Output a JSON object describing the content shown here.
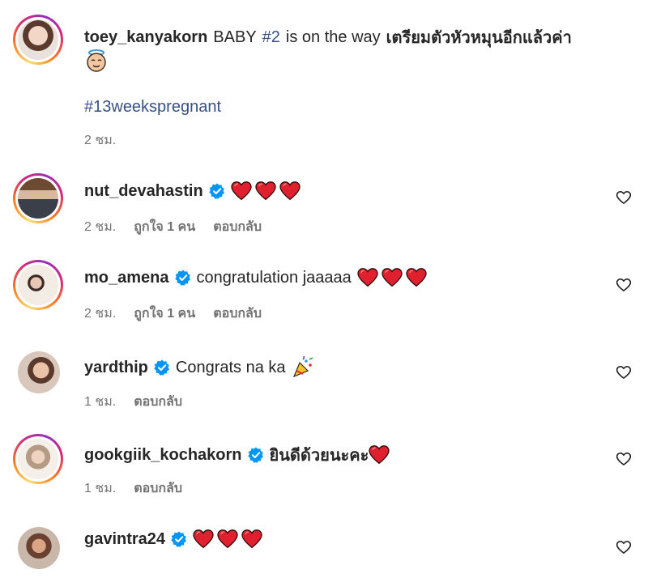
{
  "caption": {
    "username": "toey_kanyakorn",
    "text_pre": "BABY",
    "hashtag_num": "#2",
    "text_mid": "is on the way",
    "text_thai": "เตรียมตัวหัวหมุนอีกแล้วค่า",
    "hashtag": "#13weekspregnant",
    "time": "2 ชม."
  },
  "comments": [
    {
      "username": "nut_devahastin",
      "verified": true,
      "text": "",
      "emoji": [
        "red-heart",
        "red-heart",
        "red-heart"
      ],
      "time": "2 ชม.",
      "likes": "ถูกใจ 1 คน",
      "reply": "ตอบกลับ"
    },
    {
      "username": "mo_amena",
      "verified": true,
      "text": "congratulation jaaaaa",
      "emoji": [
        "red-heart",
        "red-heart",
        "red-heart"
      ],
      "time": "2 ชม.",
      "likes": "ถูกใจ 1 คน",
      "reply": "ตอบกลับ"
    },
    {
      "username": "yardthip",
      "verified": true,
      "text": "Congrats na ka",
      "emoji": [
        "party-popper"
      ],
      "time": "1 ชม.",
      "likes": "",
      "reply": "ตอบกลับ"
    },
    {
      "username": "gookgiik_kochakorn",
      "verified": true,
      "text": "ยินดีด้วยนะคะ",
      "emoji": [
        "red-heart"
      ],
      "time": "1 ชม.",
      "likes": "",
      "reply": "ตอบกลับ"
    },
    {
      "username": "gavintra24",
      "verified": true,
      "text": "",
      "emoji": [
        "red-heart",
        "red-heart",
        "red-heart"
      ],
      "time": "",
      "likes": "",
      "reply": ""
    }
  ],
  "colors": {
    "hashtag": "#385185",
    "verified": "#0095f6",
    "heart": "#e0202e",
    "meta": "#737373"
  }
}
